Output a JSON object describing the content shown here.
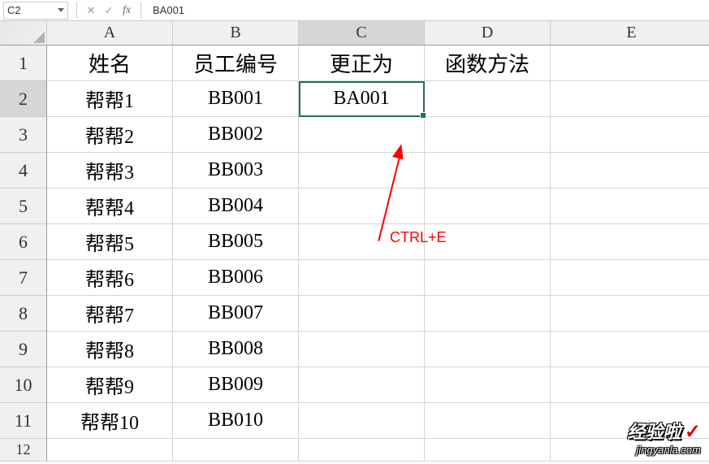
{
  "nameBox": "C2",
  "formulaValue": "BA001",
  "cancelIcon": "✕",
  "enterIcon": "✓",
  "fxLabel": "fx",
  "columns": [
    "A",
    "B",
    "C",
    "D",
    "E"
  ],
  "rowNumbers": [
    "1",
    "2",
    "3",
    "4",
    "5",
    "6",
    "7",
    "8",
    "9",
    "10",
    "11",
    "12"
  ],
  "activeCol": "C",
  "activeRow": "2",
  "chart_data": {
    "type": "table",
    "headers": [
      "姓名",
      "员工编号",
      "更正为",
      "函数方法"
    ],
    "rows": [
      [
        "帮帮1",
        "BB001",
        "BA001",
        ""
      ],
      [
        "帮帮2",
        "BB002",
        "",
        ""
      ],
      [
        "帮帮3",
        "BB003",
        "",
        ""
      ],
      [
        "帮帮4",
        "BB004",
        "",
        ""
      ],
      [
        "帮帮5",
        "BB005",
        "",
        ""
      ],
      [
        "帮帮6",
        "BB006",
        "",
        ""
      ],
      [
        "帮帮7",
        "BB007",
        "",
        ""
      ],
      [
        "帮帮8",
        "BB008",
        "",
        ""
      ],
      [
        "帮帮9",
        "BB009",
        "",
        ""
      ],
      [
        "帮帮10",
        "BB010",
        "",
        ""
      ]
    ]
  },
  "annotation": {
    "label": "CTRL+E"
  },
  "watermark": {
    "main": "经验啦",
    "check": "✓",
    "sub": "jingyanla.com"
  }
}
